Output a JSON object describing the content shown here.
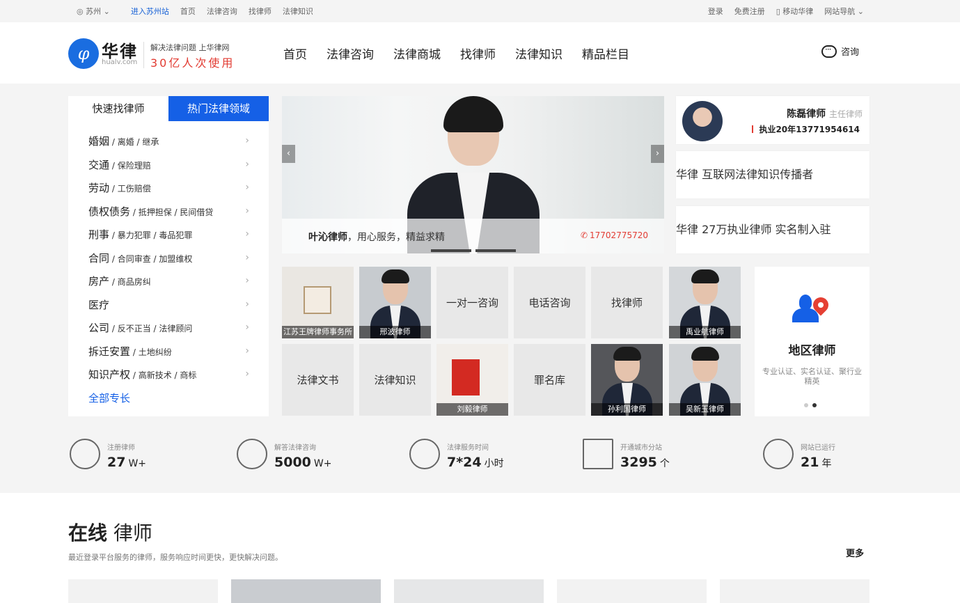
{
  "topbar": {
    "city": "苏州",
    "enter_city": "进入苏州站",
    "links": [
      "首页",
      "法律咨询",
      "找律师",
      "法律知识"
    ],
    "right_links": [
      "登录",
      "免费注册",
      "移动华律",
      "网站导航"
    ]
  },
  "header": {
    "logo_mark": "φ",
    "logo_name": "华律",
    "logo_domain": "hualv.com",
    "slogan_top": "解决法律问题 上华律网",
    "slogan_bottom": "30亿人次使用",
    "nav": [
      "首页",
      "法律咨询",
      "法律商城",
      "找律师",
      "法律知识",
      "精品栏目"
    ],
    "consult_label": "咨询"
  },
  "category": {
    "tabs": [
      "快速找律师",
      "热门法律领域"
    ],
    "active_tab": 1,
    "items": [
      {
        "main": "婚姻",
        "sub": " / 离婚 / 继承"
      },
      {
        "main": "交通",
        "sub": " / 保险理赔"
      },
      {
        "main": "劳动",
        "sub": " / 工伤赔偿"
      },
      {
        "main": "债权债务",
        "sub": " / 抵押担保 / 民间借贷"
      },
      {
        "main": "刑事",
        "sub": " / 暴力犯罪 / 毒品犯罪"
      },
      {
        "main": "合同",
        "sub": " / 合同审查 / 加盟维权"
      },
      {
        "main": "房产",
        "sub": " / 商品房纠"
      },
      {
        "main": "医疗",
        "sub": ""
      },
      {
        "main": "公司",
        "sub": " / 反不正当 / 法律顾问"
      },
      {
        "main": "拆迁安置",
        "sub": " / 土地纠纷"
      },
      {
        "main": "知识产权",
        "sub": " / 高新技术 / 商标"
      }
    ],
    "all_label": "全部专长"
  },
  "banner": {
    "name": "叶沁律师",
    "tagline": "，用心服务，精益求精",
    "phone": "17702775720",
    "prev": "‹",
    "next": "›"
  },
  "featured_lawyer": {
    "name": "陈磊律师",
    "title": "主任律师",
    "info": "执业20年13771954614"
  },
  "promo": [
    "华律 互联网法律知识传播者",
    "华律 27万执业律师 实名制入驻"
  ],
  "tiles": {
    "firm": "江苏王牌律师事务所",
    "lawyer1": "邢波律师",
    "consult_1v1": "一对一咨询",
    "phone_consult": "电话咨询",
    "find_lawyer": "找律师",
    "lawyer2": "禹业航律师",
    "documents": "法律文书",
    "knowledge": "法律知识",
    "lawyer3": "刘毅律师",
    "crimes": "罪名库",
    "lawyer4": "孙利国律师",
    "lawyer5": "吴新玉律师"
  },
  "region": {
    "title": "地区律师",
    "desc": "专业认证、实名认证、聚行业精英"
  },
  "stats": [
    {
      "label": "注册律师",
      "value": "27",
      "unit": "W+"
    },
    {
      "label": "解答法律咨询",
      "value": "5000",
      "unit": "W+"
    },
    {
      "label": "法律服务时间",
      "value": "7*24",
      "unit": "小时"
    },
    {
      "label": "开通城市分站",
      "value": "3295",
      "unit": "个"
    },
    {
      "label": "网站已运行",
      "value": "21",
      "unit": "年"
    }
  ],
  "online": {
    "title_bold": "在线",
    "title_rest": " 律师",
    "desc": "最近登录平台服务的律师，服务响应时间更快，更快解决问题。",
    "more": "更多"
  }
}
